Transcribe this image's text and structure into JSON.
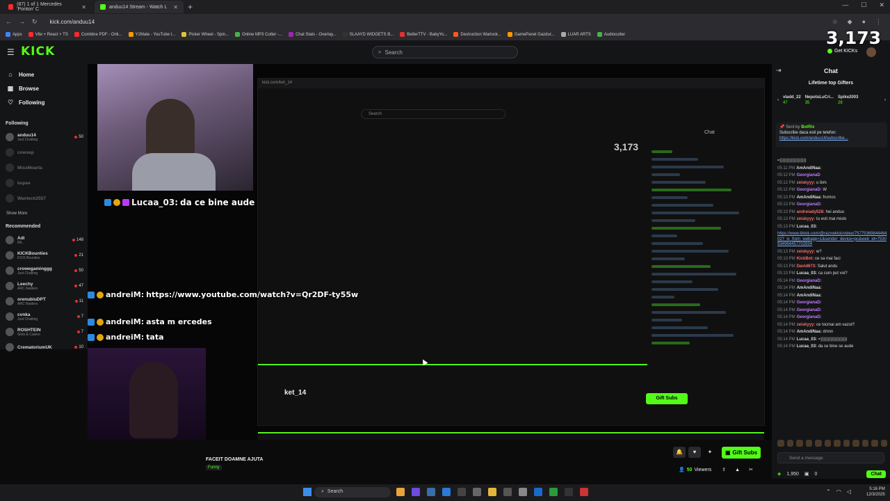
{
  "browser": {
    "tabs": [
      {
        "label": "(87) 1 of 1 Mercedes 'Ponton' C",
        "active": false
      },
      {
        "label": "anduu14 Stream - Watch L",
        "active": true
      }
    ],
    "url": "kick.com/anduu14",
    "bookmarks": [
      "Apps",
      "Vite + React + TS",
      "Combine PDF - Onli...",
      "Y2Mate - YouTube t...",
      "Picker Wheel - Spin...",
      "Online MP3 Cutter -...",
      "Chat Stats - Overlay...",
      "SLAAYD WIDGETS B...",
      "BetterTTV - BabyYo...",
      "Destruction Warlock...",
      "GamePanel Gazdur...",
      "LUAR ARTS",
      "Audiocutter"
    ]
  },
  "header": {
    "logo": "KICK",
    "search_placeholder": "Search",
    "overlay_count": "3,173",
    "get_kicks": "Get KICKs"
  },
  "sidebar": {
    "nav": [
      {
        "label": "Home",
        "icon": "home-icon"
      },
      {
        "label": "Browse",
        "icon": "browse-icon"
      },
      {
        "label": "Following",
        "icon": "heart-icon"
      }
    ],
    "following_heading": "Following",
    "following": [
      {
        "name": "anduu14",
        "sub": "Just Chatting",
        "count": "50",
        "live": true
      },
      {
        "name": "cowsep",
        "sub": "",
        "count": "",
        "live": false
      },
      {
        "name": "MissMoarta",
        "sub": "",
        "count": "",
        "live": false
      },
      {
        "name": "kopee",
        "sub": "",
        "count": "",
        "live": false
      },
      {
        "name": "Wanteck2557",
        "sub": "",
        "count": "",
        "live": false
      }
    ],
    "show_more": "Show More",
    "recommended_heading": "Recommended",
    "recommended": [
      {
        "name": "Adi",
        "sub": "IRL",
        "count": "148"
      },
      {
        "name": "KICKBounties",
        "sub": "KICK Bounties",
        "count": "21"
      },
      {
        "name": "crowegaminggg",
        "sub": "Just Chatting",
        "count": "50"
      },
      {
        "name": "Leechy",
        "sub": "ARC Raiders",
        "count": "47"
      },
      {
        "name": "orenubiuDPT",
        "sub": "ARC Raiders",
        "count": "11"
      },
      {
        "name": "cvnka",
        "sub": "Just Chatting",
        "count": "7"
      },
      {
        "name": "ROSHTEIN",
        "sub": "Slots & Casino",
        "count": "7"
      },
      {
        "name": "CrematoriumUK",
        "sub": "",
        "count": "10"
      }
    ]
  },
  "overlay_chat": [
    {
      "user": "Lucaa_03:",
      "text": "da ce bine aude"
    },
    {
      "user": "andreiM:",
      "text": "https://www.youtube.com/watch?v=Qr2DF-ty55w"
    },
    {
      "user": "andreiM:",
      "text": "asta m ercedes"
    },
    {
      "user": "andreiM:",
      "text": "tata"
    }
  ],
  "inner_stream": {
    "url": "kick.com/ket_14",
    "search": "Search",
    "count": "3,173",
    "chat_title": "Chat",
    "streamer": "ket_14",
    "gift_subs": "Gift Subs"
  },
  "stream": {
    "title": "FACEIT DOAMNE AJUTA",
    "category": "Funny",
    "viewers": "50",
    "viewers_label": "Viewers",
    "gift_subs": "Gift Subs"
  },
  "chat": {
    "title": "Chat",
    "gifters_title": "Lifetime top Gifters",
    "gifters": [
      {
        "name": "vladd_22",
        "count": "47"
      },
      {
        "name": "NepotuLuCri...",
        "count": "35"
      },
      {
        "name": "Spike2003",
        "count": "28"
      }
    ],
    "pinned": {
      "by_label": "Sent by",
      "by": "BotRix",
      "text": "Subscribe daca esti pe telefon:",
      "link": "https://kick.com/anduu14/subscribe..."
    },
    "messages": [
      {
        "time": "",
        "user": "",
        "color": "#ddd",
        "text": "=)))))))))))))))))))"
      },
      {
        "time": "05:11 PM",
        "user": "AmAndiNaa:",
        "color": "#ddd",
        "text": ""
      },
      {
        "time": "05:12 PM",
        "user": "GeorgianaD",
        "color": "#c07cff",
        "text": ""
      },
      {
        "time": "05:12 PM",
        "user": "zeiskyyy:",
        "color": "#ff6b6b",
        "text": "u ibm"
      },
      {
        "time": "05:12 PM",
        "user": "GeorgianaD:",
        "color": "#c07cff",
        "text": "W"
      },
      {
        "time": "05:13 PM",
        "user": "AmAndiNaa:",
        "color": "#ddd",
        "text": "frumos"
      },
      {
        "time": "05:13 PM",
        "user": "GeorgianaD:",
        "color": "#c07cff",
        "text": ""
      },
      {
        "time": "05:13 PM",
        "user": "andreiady528:",
        "color": "#ff6b6b",
        "text": "hei anduu"
      },
      {
        "time": "05:13 PM",
        "user": "zeiskyyy:",
        "color": "#ff6b6b",
        "text": "tu esti mai misto"
      },
      {
        "time": "05:13 PM",
        "user": "Lucaa_03:",
        "color": "#ddd",
        "text": ""
      },
      {
        "time": "",
        "user": "",
        "color": "#ddd",
        "text": "",
        "link": "https://www.tiktok.com/@razvwkick/video/7577536984446402?_is_from_webapp=1&sender_device=pc&web_id=7530934964457702934"
      },
      {
        "time": "05:13 PM",
        "user": "zeiskyyy:",
        "color": "#ff6b6b",
        "text": "w?"
      },
      {
        "time": "05:13 PM",
        "user": "KickBot:",
        "color": "#ff6b6b",
        "text": "ce sa mai faci"
      },
      {
        "time": "05:13 PM",
        "user": "David673:",
        "color": "#ff6b6b",
        "text": "Salut andu"
      },
      {
        "time": "05:13 PM",
        "user": "Lucaa_03:",
        "color": "#ddd",
        "text": "ca cum put voi?"
      },
      {
        "time": "05:14 PM",
        "user": "GeorgianaD:",
        "color": "#c07cff",
        "text": ""
      },
      {
        "time": "05:14 PM",
        "user": "AmAndiNaa:",
        "color": "#ddd",
        "text": ""
      },
      {
        "time": "05:14 PM",
        "user": "AmAndiNaa:",
        "color": "#ddd",
        "text": ""
      },
      {
        "time": "05:14 PM",
        "user": "GeorgianaD:",
        "color": "#c07cff",
        "text": ""
      },
      {
        "time": "05:14 PM",
        "user": "GeorgianaD:",
        "color": "#c07cff",
        "text": ""
      },
      {
        "time": "05:14 PM",
        "user": "GeorgianaD:",
        "color": "#c07cff",
        "text": ""
      },
      {
        "time": "05:14 PM",
        "user": "zeiskyyy:",
        "color": "#ff6b6b",
        "text": "ce tocmai am vazut?"
      },
      {
        "time": "05:14 PM",
        "user": "AmAndiNaa:",
        "color": "#ddd",
        "text": "dmnn"
      },
      {
        "time": "05:14 PM",
        "user": "Lucaa_03:",
        "color": "#ddd",
        "text": "=)))))))))))))))))))"
      },
      {
        "time": "05:14 PM",
        "user": "Lucaa_03:",
        "color": "#ddd",
        "text": "da ce bine se aude"
      }
    ],
    "input_placeholder": "Send a message",
    "footer_points": "1,950",
    "footer_other": "0",
    "chat_button": "Chat"
  },
  "taskbar": {
    "search": "Search",
    "time": "5:16 PM",
    "date": "12/3/2025"
  },
  "colors": {
    "kick_green": "#53fc18",
    "background": "#0b0b0c",
    "panel": "#141517"
  }
}
